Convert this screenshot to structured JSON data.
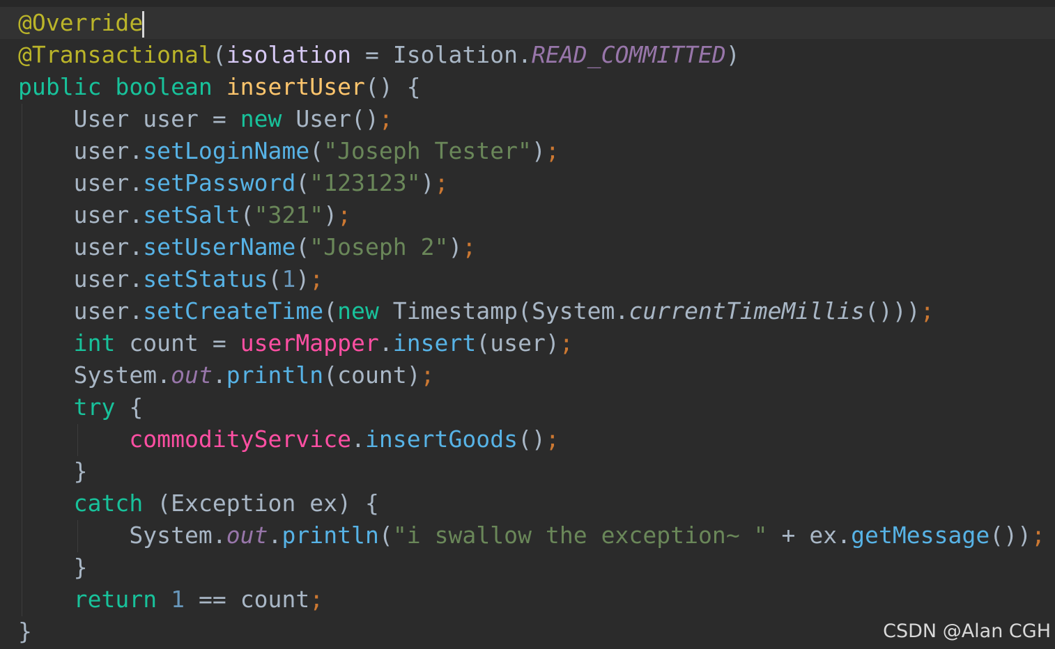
{
  "editor": {
    "theme": {
      "background": "#2b2b2b",
      "annotation": "#bbb529",
      "keyword": "#18c29b",
      "method_declaration": "#ffc66d",
      "method_call": "#57b3e6",
      "field": "#ff4fa3",
      "string": "#6a8759",
      "number": "#6897bb",
      "semicolon": "#cc7832",
      "constant": "#9876aa",
      "default_text": "#a9b7c6"
    },
    "lines": [
      {
        "tokens": [
          {
            "t": "@Override",
            "c": "ann"
          }
        ],
        "caret": true
      },
      {
        "tokens": [
          {
            "t": "@Transactional",
            "c": "ann"
          },
          {
            "t": "("
          },
          {
            "t": "isolation",
            "c": "param"
          },
          {
            "t": " = Isolation."
          },
          {
            "t": "READ_COMMITTED",
            "c": "const"
          },
          {
            "t": ")"
          }
        ]
      },
      {
        "tokens": [
          {
            "t": "public boolean ",
            "c": "kw"
          },
          {
            "t": "insertUser",
            "c": "fn"
          },
          {
            "t": "() {"
          }
        ]
      },
      {
        "tokens": [
          {
            "t": "    User user = "
          },
          {
            "t": "new ",
            "c": "kw"
          },
          {
            "t": "User()"
          },
          {
            "t": ";",
            "c": "semi"
          }
        ]
      },
      {
        "tokens": [
          {
            "t": "    user."
          },
          {
            "t": "setLoginName",
            "c": "meth"
          },
          {
            "t": "("
          },
          {
            "t": "\"Joseph Tester\"",
            "c": "str"
          },
          {
            "t": ")"
          },
          {
            "t": ";",
            "c": "semi"
          }
        ]
      },
      {
        "tokens": [
          {
            "t": "    user."
          },
          {
            "t": "setPassword",
            "c": "meth"
          },
          {
            "t": "("
          },
          {
            "t": "\"123123\"",
            "c": "str"
          },
          {
            "t": ")"
          },
          {
            "t": ";",
            "c": "semi"
          }
        ]
      },
      {
        "tokens": [
          {
            "t": "    user."
          },
          {
            "t": "setSalt",
            "c": "meth"
          },
          {
            "t": "("
          },
          {
            "t": "\"321\"",
            "c": "str"
          },
          {
            "t": ")"
          },
          {
            "t": ";",
            "c": "semi"
          }
        ]
      },
      {
        "tokens": [
          {
            "t": "    user."
          },
          {
            "t": "setUserName",
            "c": "meth"
          },
          {
            "t": "("
          },
          {
            "t": "\"Joseph 2\"",
            "c": "str"
          },
          {
            "t": ")"
          },
          {
            "t": ";",
            "c": "semi"
          }
        ]
      },
      {
        "tokens": [
          {
            "t": "    user."
          },
          {
            "t": "setStatus",
            "c": "meth"
          },
          {
            "t": "("
          },
          {
            "t": "1",
            "c": "num"
          },
          {
            "t": ")"
          },
          {
            "t": ";",
            "c": "semi"
          }
        ]
      },
      {
        "tokens": [
          {
            "t": "    user."
          },
          {
            "t": "setCreateTime",
            "c": "meth"
          },
          {
            "t": "("
          },
          {
            "t": "new ",
            "c": "kw"
          },
          {
            "t": "Timestamp(System."
          },
          {
            "t": "currentTimeMillis",
            "c": "static"
          },
          {
            "t": "()))"
          },
          {
            "t": ";",
            "c": "semi"
          }
        ]
      },
      {
        "tokens": [
          {
            "t": "    "
          },
          {
            "t": "int ",
            "c": "kw"
          },
          {
            "t": "count = "
          },
          {
            "t": "userMapper",
            "c": "field"
          },
          {
            "t": "."
          },
          {
            "t": "insert",
            "c": "meth"
          },
          {
            "t": "(user)"
          },
          {
            "t": ";",
            "c": "semi"
          }
        ]
      },
      {
        "tokens": [
          {
            "t": "    System."
          },
          {
            "t": "out",
            "c": "const"
          },
          {
            "t": "."
          },
          {
            "t": "println",
            "c": "meth"
          },
          {
            "t": "(count)"
          },
          {
            "t": ";",
            "c": "semi"
          }
        ]
      },
      {
        "tokens": [
          {
            "t": "    "
          },
          {
            "t": "try ",
            "c": "kw"
          },
          {
            "t": "{"
          }
        ]
      },
      {
        "tokens": [
          {
            "t": "        "
          },
          {
            "t": "commodityService",
            "c": "field"
          },
          {
            "t": "."
          },
          {
            "t": "insertGoods",
            "c": "meth"
          },
          {
            "t": "()"
          },
          {
            "t": ";",
            "c": "semi"
          }
        ]
      },
      {
        "tokens": [
          {
            "t": "    }"
          }
        ]
      },
      {
        "tokens": [
          {
            "t": "    "
          },
          {
            "t": "catch ",
            "c": "kw"
          },
          {
            "t": "(Exception ex) {"
          }
        ]
      },
      {
        "tokens": [
          {
            "t": "        System."
          },
          {
            "t": "out",
            "c": "const"
          },
          {
            "t": "."
          },
          {
            "t": "println",
            "c": "meth"
          },
          {
            "t": "("
          },
          {
            "t": "\"i swallow the exception~ \"",
            "c": "str"
          },
          {
            "t": " + ex."
          },
          {
            "t": "getMessage",
            "c": "meth"
          },
          {
            "t": "())"
          },
          {
            "t": ";",
            "c": "semi"
          }
        ]
      },
      {
        "tokens": [
          {
            "t": "    }"
          }
        ]
      },
      {
        "tokens": [
          {
            "t": "    "
          },
          {
            "t": "return ",
            "c": "kw"
          },
          {
            "t": "1",
            "c": "num"
          },
          {
            "t": " == count"
          },
          {
            "t": ";",
            "c": "semi"
          }
        ]
      },
      {
        "tokens": [
          {
            "t": "}"
          }
        ]
      }
    ]
  },
  "watermark": "CSDN @Alan CGH"
}
